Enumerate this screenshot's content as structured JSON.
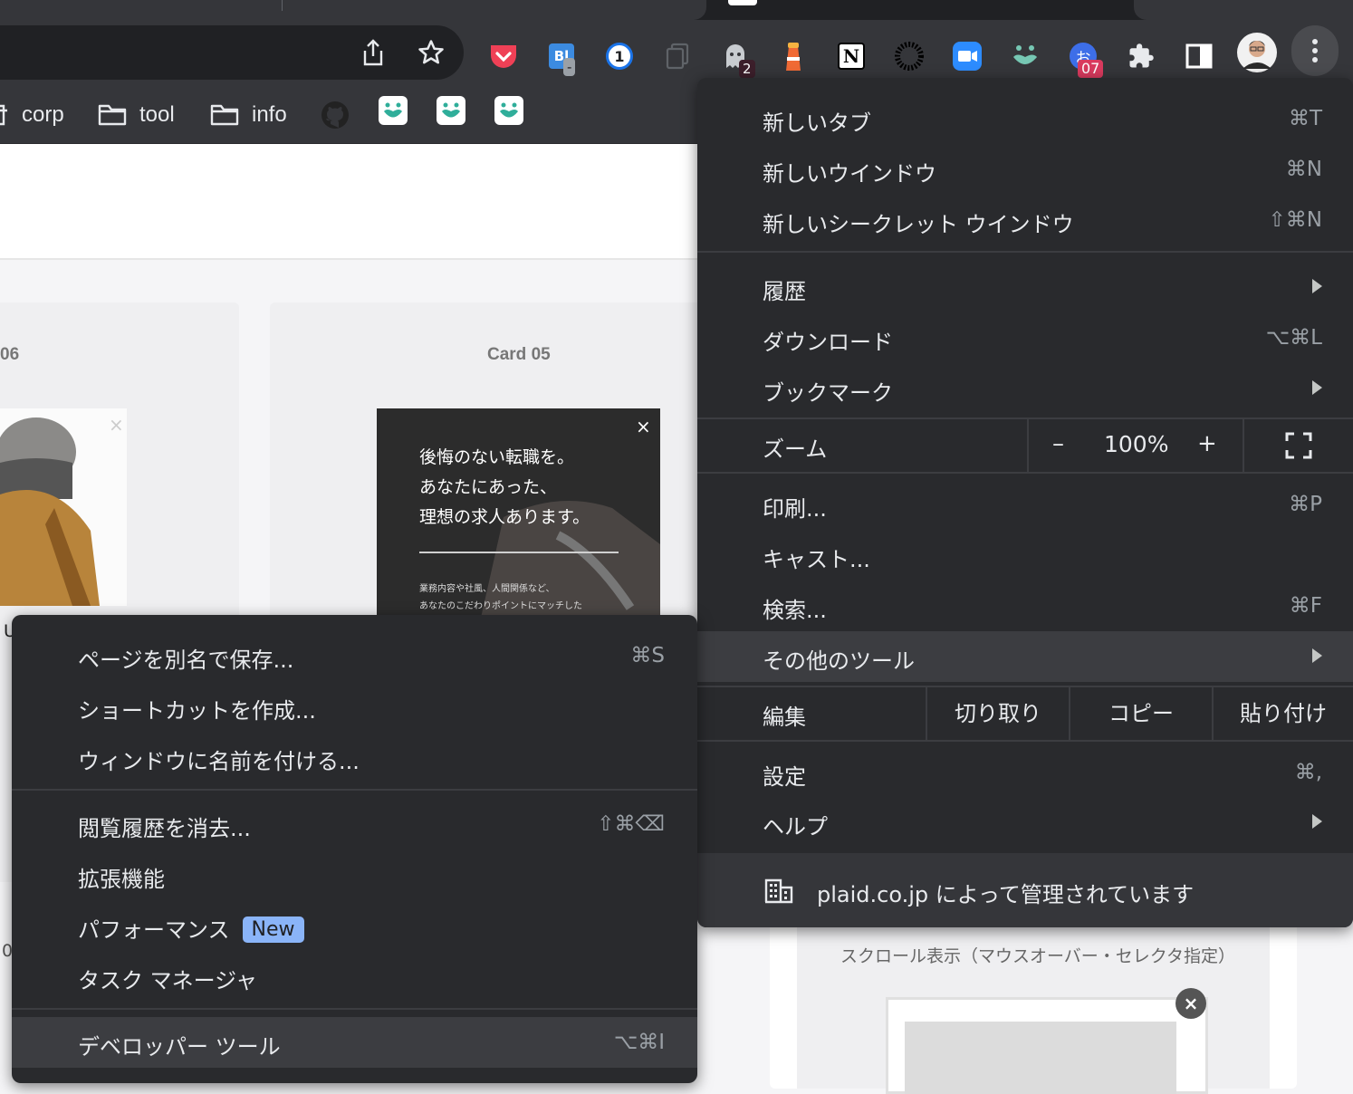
{
  "toolbar": {
    "extensions": [
      {
        "name": "pocket"
      },
      {
        "name": "bl-extension",
        "text": "Bl",
        "badge": "-"
      },
      {
        "name": "onepassword",
        "text": "1"
      },
      {
        "name": "copy-extension"
      },
      {
        "name": "ghostery",
        "badge": "2"
      },
      {
        "name": "lighthouse"
      },
      {
        "name": "notion",
        "text": "N"
      },
      {
        "name": "burst-extension"
      },
      {
        "name": "zoom"
      },
      {
        "name": "karte"
      },
      {
        "name": "o-extension",
        "text": "お",
        "badge": "07"
      },
      {
        "name": "extensions-puzzle"
      },
      {
        "name": "side-panel"
      },
      {
        "name": "profile-avatar"
      },
      {
        "name": "kebab-menu"
      }
    ],
    "badge_red": "#d93a5e",
    "badge_dark": "#3c1f2b"
  },
  "bookmarks": [
    {
      "label": "corp"
    },
    {
      "label": "tool"
    },
    {
      "label": "info"
    }
  ],
  "page": {
    "card_left_title": "06",
    "card_right_title": "Card 05",
    "banner_text": "後悔のない転職を。\nあなたにあった、\n理想の求人あります。",
    "banner_small": "業務内容や社風、人間関係など、\nあなたのこだわりポイントにマッチした",
    "left_partial_letter": "U",
    "left_partial_zero": "0",
    "scroll_caption": "スクロール表示（マウスオーバー・セレクタ指定）"
  },
  "menu": {
    "new_tab": {
      "label": "新しいタブ",
      "shortcut": "⌘T"
    },
    "new_window": {
      "label": "新しいウインドウ",
      "shortcut": "⌘N"
    },
    "incognito": {
      "label": "新しいシークレット ウインドウ",
      "shortcut": "⇧⌘N"
    },
    "history": {
      "label": "履歴"
    },
    "downloads": {
      "label": "ダウンロード",
      "shortcut": "⌥⌘L"
    },
    "bookmarks": {
      "label": "ブックマーク"
    },
    "zoom": {
      "label": "ズーム",
      "minus": "–",
      "value": "100%",
      "plus": "+"
    },
    "print": {
      "label": "印刷...",
      "shortcut": "⌘P"
    },
    "cast": {
      "label": "キャスト..."
    },
    "find": {
      "label": "検索...",
      "shortcut": "⌘F"
    },
    "more_tools": {
      "label": "その他のツール"
    },
    "edit": {
      "label": "編集",
      "cut": "切り取り",
      "copy": "コピー",
      "paste": "貼り付け"
    },
    "settings": {
      "label": "設定",
      "shortcut": "⌘,"
    },
    "help": {
      "label": "ヘルプ"
    },
    "managed": {
      "label": "plaid.co.jp によって管理されています"
    }
  },
  "submenu": {
    "save_as": {
      "label": "ページを別名で保存...",
      "shortcut": "⌘S"
    },
    "create_shortcut": {
      "label": "ショートカットを作成..."
    },
    "name_window": {
      "label": "ウィンドウに名前を付ける..."
    },
    "clear_data": {
      "label": "閲覧履歴を消去...",
      "shortcut": "⇧⌘⌫"
    },
    "extensions": {
      "label": "拡張機能"
    },
    "performance": {
      "label": "パフォーマンス",
      "badge": "New"
    },
    "task_manager": {
      "label": "タスク マネージャ"
    },
    "devtools": {
      "label": "デベロッパー ツール",
      "shortcut": "⌥⌘I"
    }
  }
}
